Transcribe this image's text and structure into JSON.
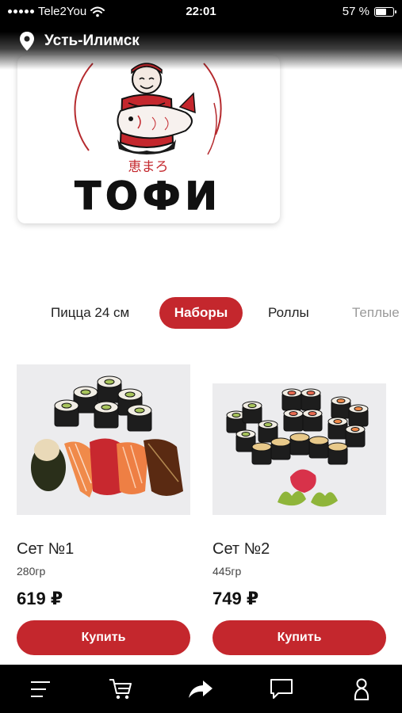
{
  "status_bar": {
    "carrier": "Tele2You",
    "time": "22:01",
    "battery_percent_label": "57 %",
    "battery_level": 0.57
  },
  "location": {
    "city": "Усть-Илимск",
    "icon": "location-pin-icon"
  },
  "logo": {
    "brand_name": "ТОФИ",
    "japanese_text": "恵まろ"
  },
  "categories": [
    {
      "label": "Пицца 24 см",
      "active": false
    },
    {
      "label": "Наборы",
      "active": true
    },
    {
      "label": "Роллы",
      "active": false
    },
    {
      "label": "Теплые",
      "active": false
    }
  ],
  "products": [
    {
      "name": "Сет №1",
      "weight": "280гр",
      "price": "619 ₽",
      "buy_label": "Купить"
    },
    {
      "name": "Сет №2",
      "weight": "445гр",
      "price": "749 ₽",
      "buy_label": "Купить"
    }
  ],
  "bottom_nav": [
    {
      "icon": "menu-icon"
    },
    {
      "icon": "cart-icon"
    },
    {
      "icon": "share-icon"
    },
    {
      "icon": "chat-icon"
    },
    {
      "icon": "user-icon"
    }
  ],
  "colors": {
    "accent": "#c4272d",
    "nav_background": "#000000"
  }
}
